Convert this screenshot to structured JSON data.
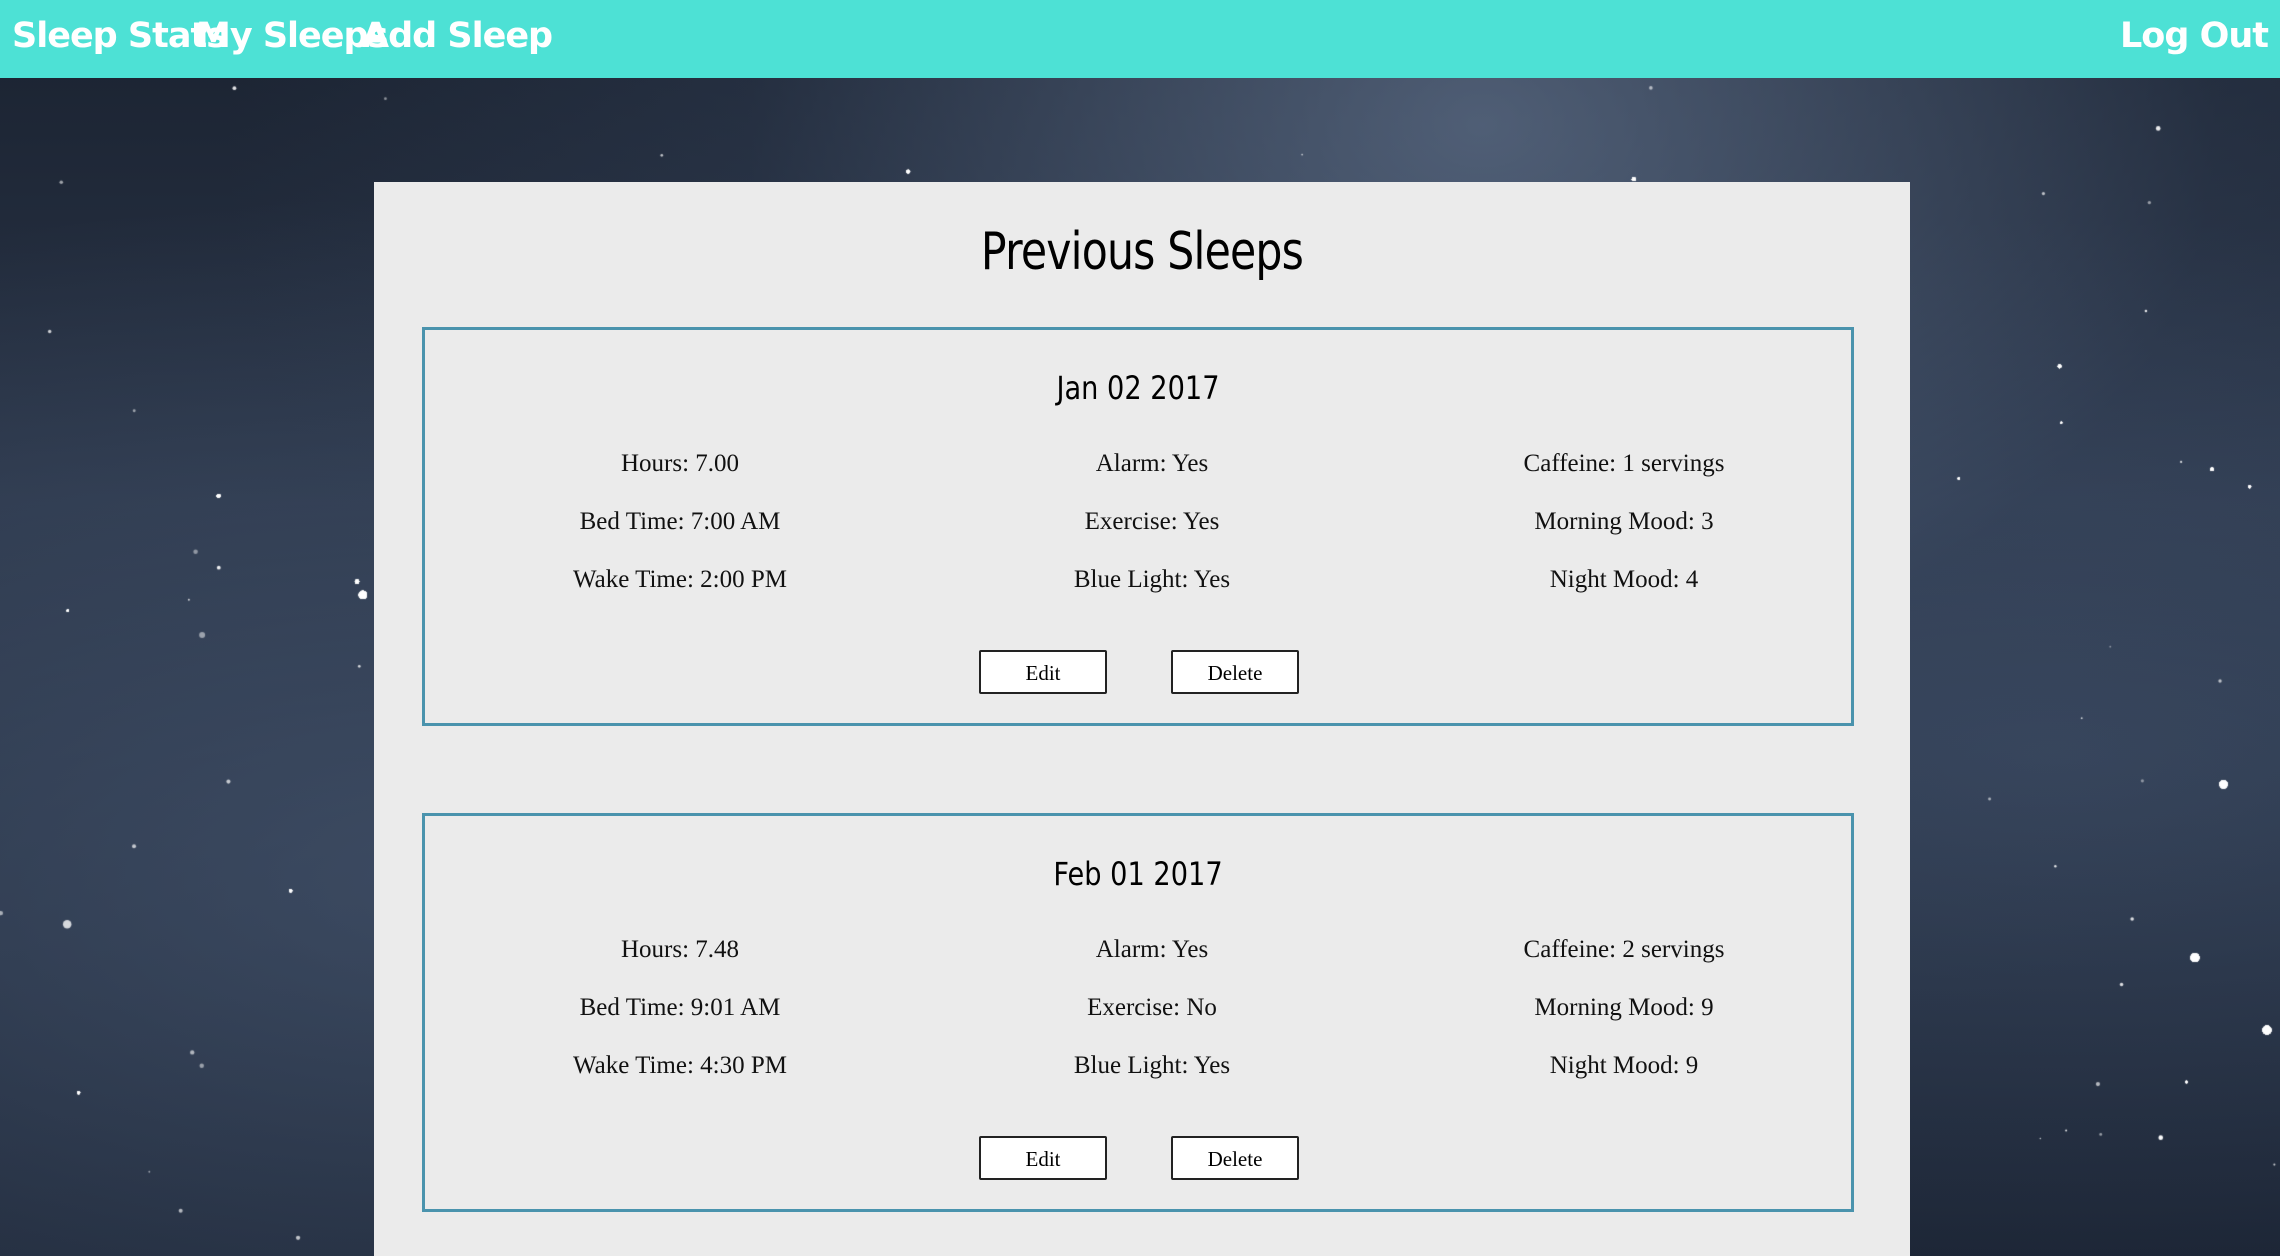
{
  "nav": {
    "sleep_stats": "Sleep Stats",
    "my_sleeps": "My Sleeps",
    "add_sleep": "Add Sleep",
    "log_out": "Log Out"
  },
  "page": {
    "title": "Previous Sleeps"
  },
  "colors": {
    "navbar": "#4de1d5",
    "panel": "#ebebeb",
    "card_border": "#4a93ad"
  },
  "sleeps": [
    {
      "date": "Jan 02 2017",
      "hours": "Hours: 7.00",
      "bed_time": "Bed Time: 7:00 AM",
      "wake_time": "Wake Time: 2:00 PM",
      "alarm": "Alarm: Yes",
      "exercise": "Exercise: Yes",
      "blue_light": "Blue Light: Yes",
      "caffeine": "Caffeine: 1 servings",
      "morning_mood": "Morning Mood: 3",
      "night_mood": "Night Mood: 4",
      "edit_label": "Edit",
      "delete_label": "Delete"
    },
    {
      "date": "Feb 01 2017",
      "hours": "Hours: 7.48",
      "bed_time": "Bed Time: 9:01 AM",
      "wake_time": "Wake Time: 4:30 PM",
      "alarm": "Alarm: Yes",
      "exercise": "Exercise: No",
      "blue_light": "Blue Light: Yes",
      "caffeine": "Caffeine: 2 servings",
      "morning_mood": "Morning Mood: 9",
      "night_mood": "Night Mood: 9",
      "edit_label": "Edit",
      "delete_label": "Delete"
    }
  ]
}
